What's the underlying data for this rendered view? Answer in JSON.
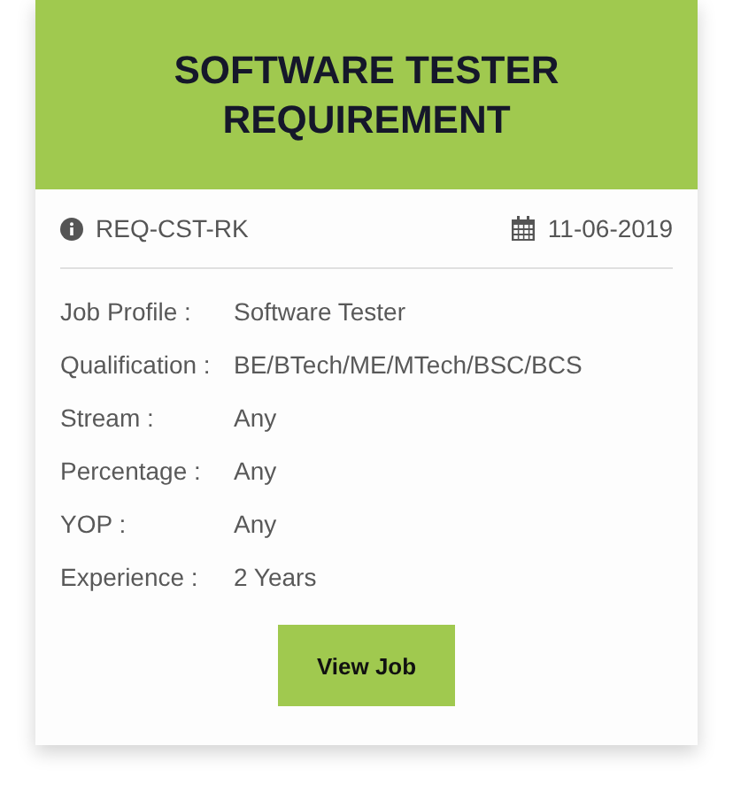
{
  "card": {
    "title": "SOFTWARE TESTER REQUIREMENT",
    "reference": "REQ-CST-RK",
    "date": "11-06-2019",
    "details": [
      {
        "label": "Job Profile :",
        "value": "Software Tester"
      },
      {
        "label": "Qualification :",
        "value": "BE/BTech/ME/MTech/BSC/BCS"
      },
      {
        "label": "Stream :",
        "value": "Any"
      },
      {
        "label": "Percentage :",
        "value": "Any"
      },
      {
        "label": "YOP :",
        "value": "Any"
      },
      {
        "label": "Experience :",
        "value": "2 Years"
      }
    ],
    "button": "View Job"
  }
}
